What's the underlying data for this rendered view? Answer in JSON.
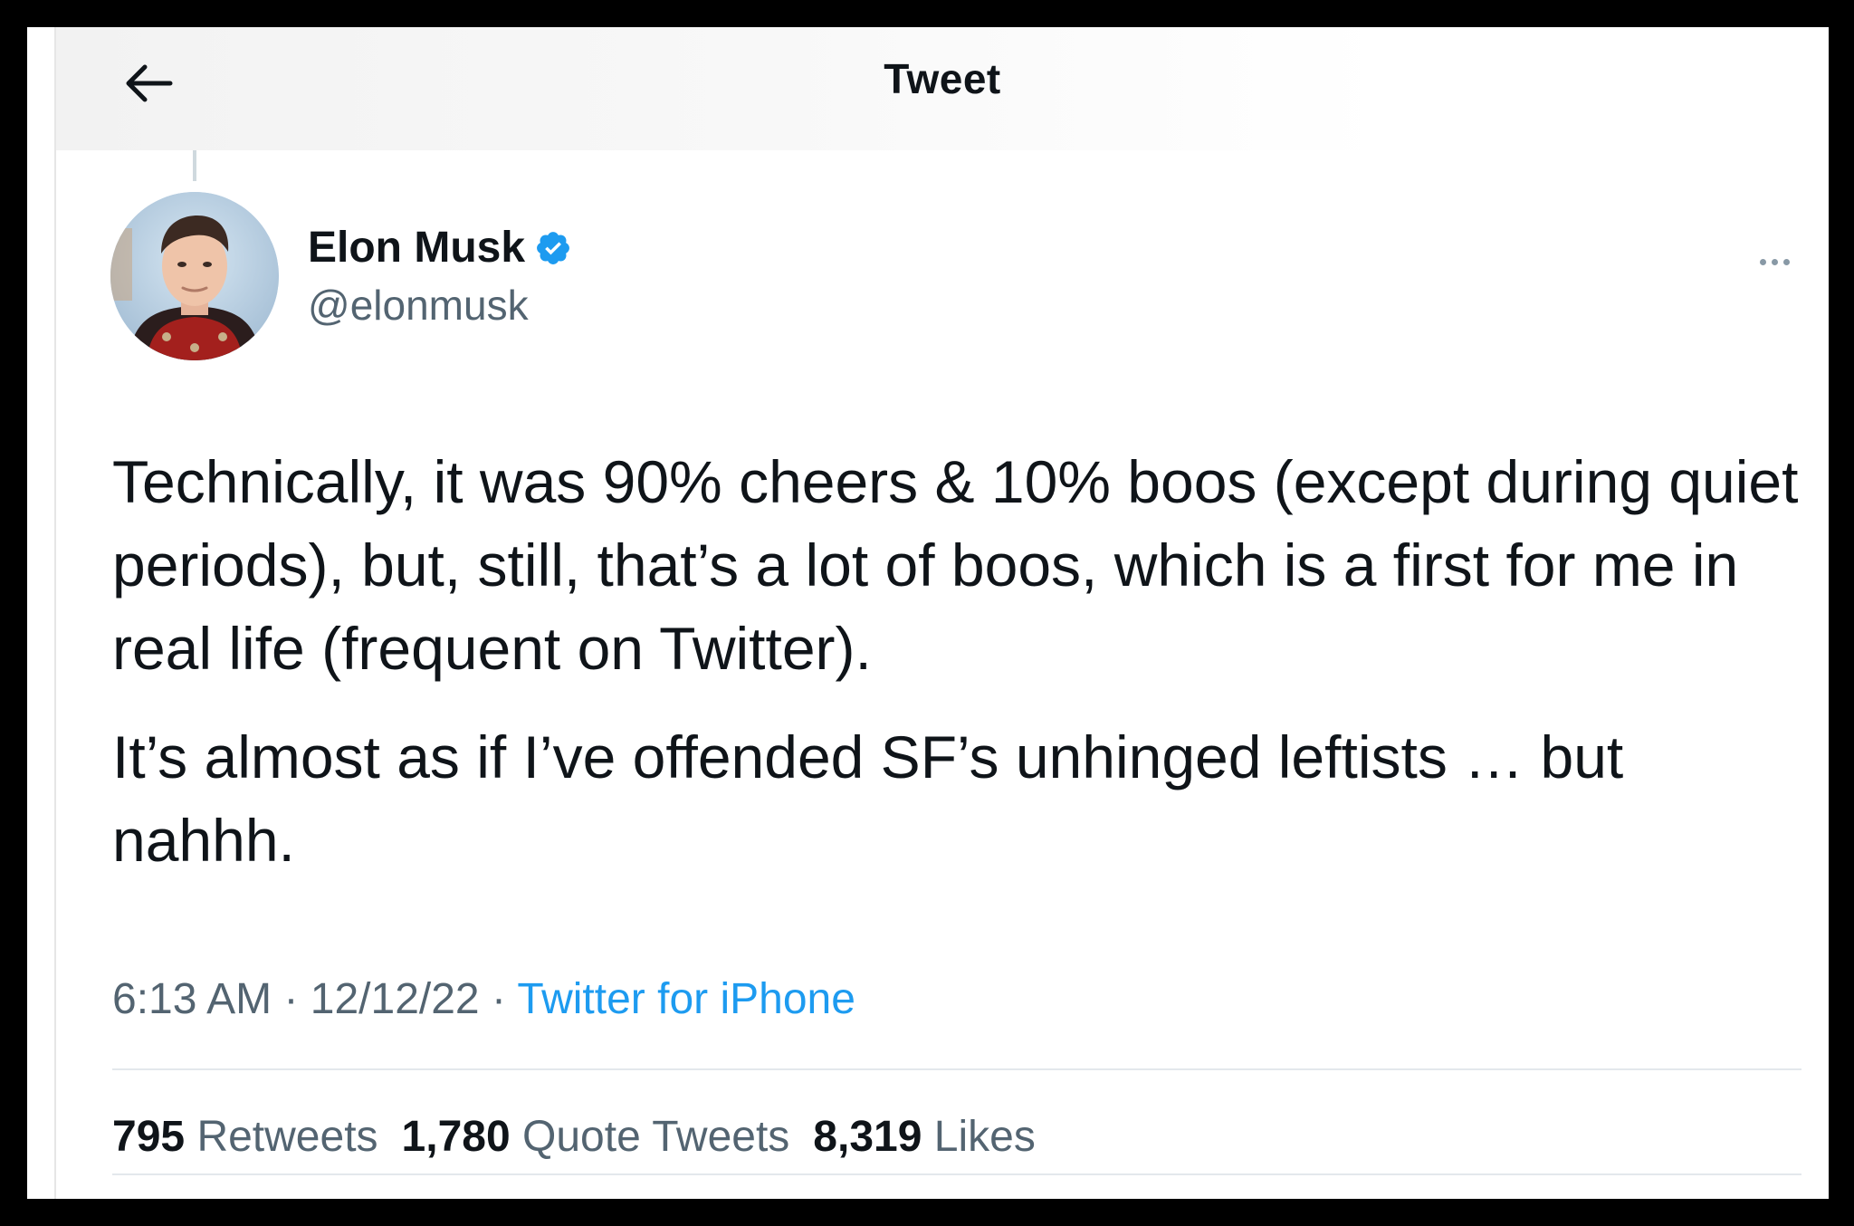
{
  "header": {
    "title": "Tweet",
    "back_icon": "arrow-left-icon"
  },
  "author": {
    "display_name": "Elon Musk",
    "handle": "@elonmusk",
    "verified_icon": "verified-badge-icon",
    "verified_color": "#1d9bf0"
  },
  "tweet": {
    "paragraphs": [
      "Technically, it was 90% cheers & 10% boos (except during quiet periods), but, still, that’s a lot of boos, which is a first for me in real life (frequent on Twitter).",
      "It’s almost as if I’ve offended SF’s unhinged leftists … but nahhh."
    ],
    "time": "6:13 AM",
    "separator": "·",
    "date": "12/12/22",
    "source": "Twitter for iPhone"
  },
  "stats": {
    "retweets_count": "795",
    "retweets_label": "Retweets",
    "quotes_count": "1,780",
    "quotes_label": "Quote Tweets",
    "likes_count": "8,319",
    "likes_label": "Likes"
  },
  "colors": {
    "link": "#1d9bf0",
    "secondary_text": "#536471",
    "primary_text": "#0f1419",
    "frame_background": "#000000"
  }
}
